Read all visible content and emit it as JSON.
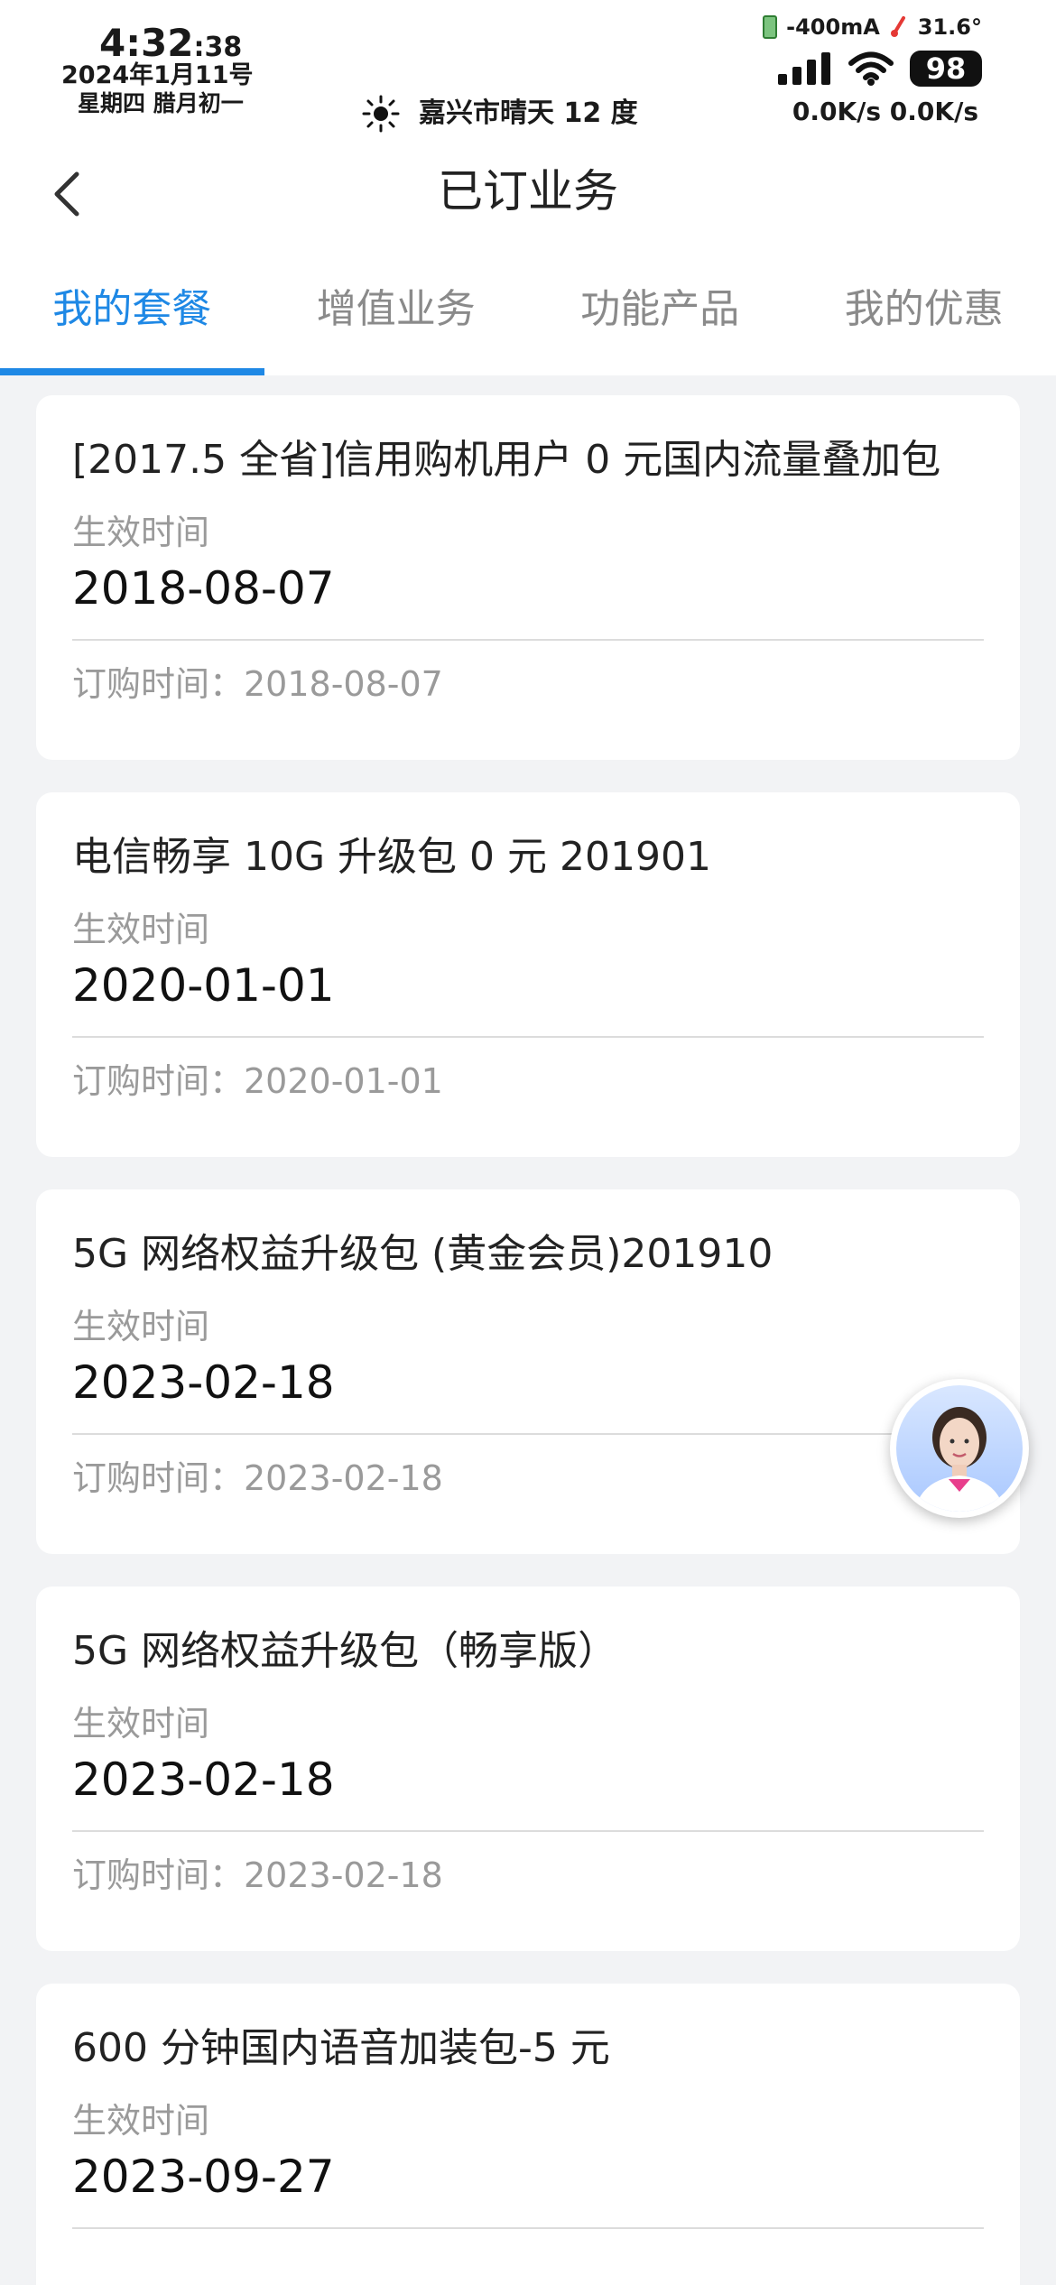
{
  "status_bar": {
    "time_main": "4:32",
    "time_seconds": ":38",
    "date": "2024年1月11号",
    "lunar": "星期四 腊月初一",
    "weather": "嘉兴市晴天 12 度",
    "current": "-400mA",
    "temperature": "31.6°",
    "battery_level": "98",
    "net_speed": "0.0K/s 0.0K/s"
  },
  "nav": {
    "title": "已订业务"
  },
  "tabs": [
    {
      "label": "我的套餐",
      "active": true
    },
    {
      "label": "增值业务",
      "active": false
    },
    {
      "label": "功能产品",
      "active": false
    },
    {
      "label": "我的优惠",
      "active": false
    }
  ],
  "effective_label": "生效时间",
  "cards": [
    {
      "title": "[2017.5 全省]信用购机用户 0 元国内流量叠加包",
      "effective_date": "2018-08-07",
      "order_text": "订购时间：2018-08-07"
    },
    {
      "title": "电信畅享 10G 升级包 0 元 201901",
      "effective_date": "2020-01-01",
      "order_text": "订购时间：2020-01-01"
    },
    {
      "title": "5G 网络权益升级包 (黄金会员)201910",
      "effective_date": "2023-02-18",
      "order_text": "订购时间：2023-02-18"
    },
    {
      "title": "5G 网络权益升级包（畅享版）",
      "effective_date": "2023-02-18",
      "order_text": "订购时间：2023-02-18"
    },
    {
      "title": "600 分钟国内语音加装包-5 元",
      "effective_date": "2023-09-27",
      "order_text": ""
    }
  ],
  "colors": {
    "accent": "#1e88e5",
    "background": "#f2f3f5"
  }
}
